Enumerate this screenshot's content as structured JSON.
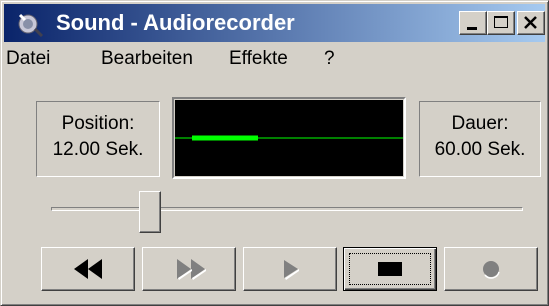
{
  "window": {
    "title": "Sound - Audiorecorder",
    "icon": "sound-recorder-icon"
  },
  "caption_buttons": [
    "minimize-icon",
    "maximize-icon",
    "close-icon"
  ],
  "menu": [
    {
      "label": "Datei"
    },
    {
      "label": "Bearbeiten"
    },
    {
      "label": "Effekte"
    },
    {
      "label": "?"
    }
  ],
  "position": {
    "label": "Position:",
    "value": "12.00 Sek."
  },
  "duration": {
    "label": "Dauer:",
    "value": "60.00 Sek."
  },
  "playback": {
    "position_seconds": 12.0,
    "duration_seconds": 60.0
  },
  "waveform": {
    "color": "#00ff00",
    "background": "#000000"
  },
  "transport": [
    {
      "name": "rewind-button",
      "icon": "rewind-icon",
      "enabled": true
    },
    {
      "name": "forward-button",
      "icon": "fast-forward-icon",
      "enabled": false
    },
    {
      "name": "play-button",
      "icon": "play-icon",
      "enabled": false
    },
    {
      "name": "stop-button",
      "icon": "stop-icon",
      "enabled": true,
      "focused": true
    },
    {
      "name": "record-button",
      "icon": "record-icon",
      "enabled": false
    }
  ]
}
